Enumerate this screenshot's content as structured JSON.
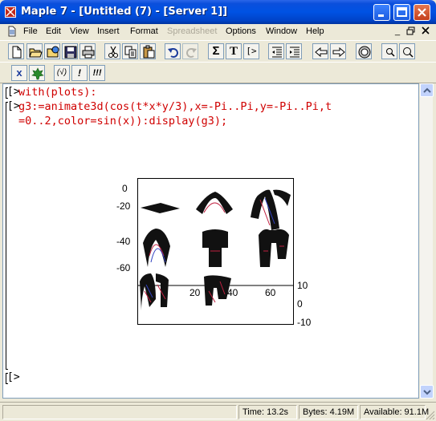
{
  "window": {
    "title": "Maple 7  - [Untitled (7) - [Server 1]]"
  },
  "menu": [
    {
      "label": "File",
      "enabled": true
    },
    {
      "label": "Edit",
      "enabled": true
    },
    {
      "label": "View",
      "enabled": true
    },
    {
      "label": "Insert",
      "enabled": true
    },
    {
      "label": "Format",
      "enabled": true
    },
    {
      "label": "Spreadsheet",
      "enabled": false
    },
    {
      "label": "Options",
      "enabled": true
    },
    {
      "label": "Window",
      "enabled": true
    },
    {
      "label": "Help",
      "enabled": true
    }
  ],
  "toolbar2": {
    "greek_btn": "x",
    "exec_btn": "(√)",
    "bang_btn": "!",
    "bang3_btn": "!!!"
  },
  "toolbar1": {
    "sigma_btn": "Σ",
    "text_btn": "T",
    "prompt_btn": "[>"
  },
  "worksheet": {
    "prompt_symbol": "[>",
    "line1": "with(plots):",
    "line2a": "g3:=animate3d(cos(t*x*y/3),x=-Pi..Pi,y=-Pi..Pi,t",
    "line2b": "=0..2,color=sin(x)):display(g3);",
    "empty_prompt": "[>"
  },
  "plot": {
    "y_ticks": [
      "0",
      "-20",
      "-40",
      "-60"
    ],
    "x_ticks": [
      "20",
      "40",
      "60"
    ],
    "z_ticks": [
      "10",
      "0",
      "-10"
    ]
  },
  "status": {
    "time": "Time:  13.2s",
    "bytes": "Bytes: 4.19M",
    "available": "Available: 91.1M"
  }
}
